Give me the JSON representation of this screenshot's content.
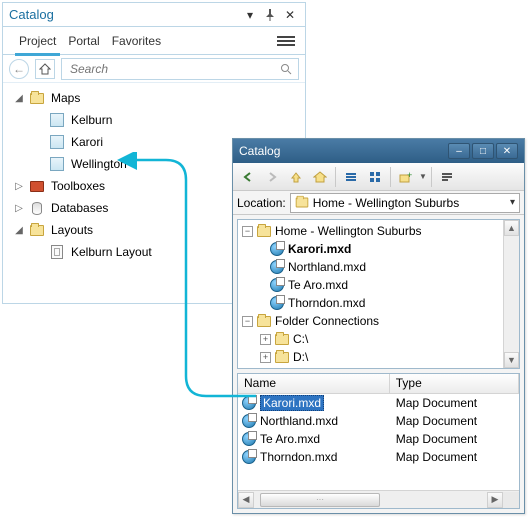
{
  "pane": {
    "title": "Catalog",
    "tabs": [
      "Project",
      "Portal",
      "Favorites"
    ],
    "active_tab": 0,
    "search_placeholder": "Search",
    "tree": {
      "maps": {
        "label": "Maps",
        "items": [
          "Kelburn",
          "Karori",
          "Wellington"
        ]
      },
      "toolboxes": {
        "label": "Toolboxes"
      },
      "databases": {
        "label": "Databases"
      },
      "layouts": {
        "label": "Layouts",
        "items": [
          "Kelburn Layout"
        ]
      }
    }
  },
  "win": {
    "title": "Catalog",
    "location_label": "Location:",
    "location_value": "Home - Wellington Suburbs",
    "tree": {
      "home": {
        "label": "Home - Wellington Suburbs",
        "files": [
          "Karori.mxd",
          "Northland.mxd",
          "Te Aro.mxd",
          "Thorndon.mxd"
        ],
        "selected": 0
      },
      "folder_connections": {
        "label": "Folder Connections",
        "drives": [
          "C:\\",
          "D:\\"
        ]
      }
    },
    "list": {
      "cols": [
        "Name",
        "Type"
      ],
      "type_label": "Map Document",
      "rows": [
        "Karori.mxd",
        "Northland.mxd",
        "Te Aro.mxd",
        "Thorndon.mxd"
      ],
      "selected": 0
    }
  }
}
